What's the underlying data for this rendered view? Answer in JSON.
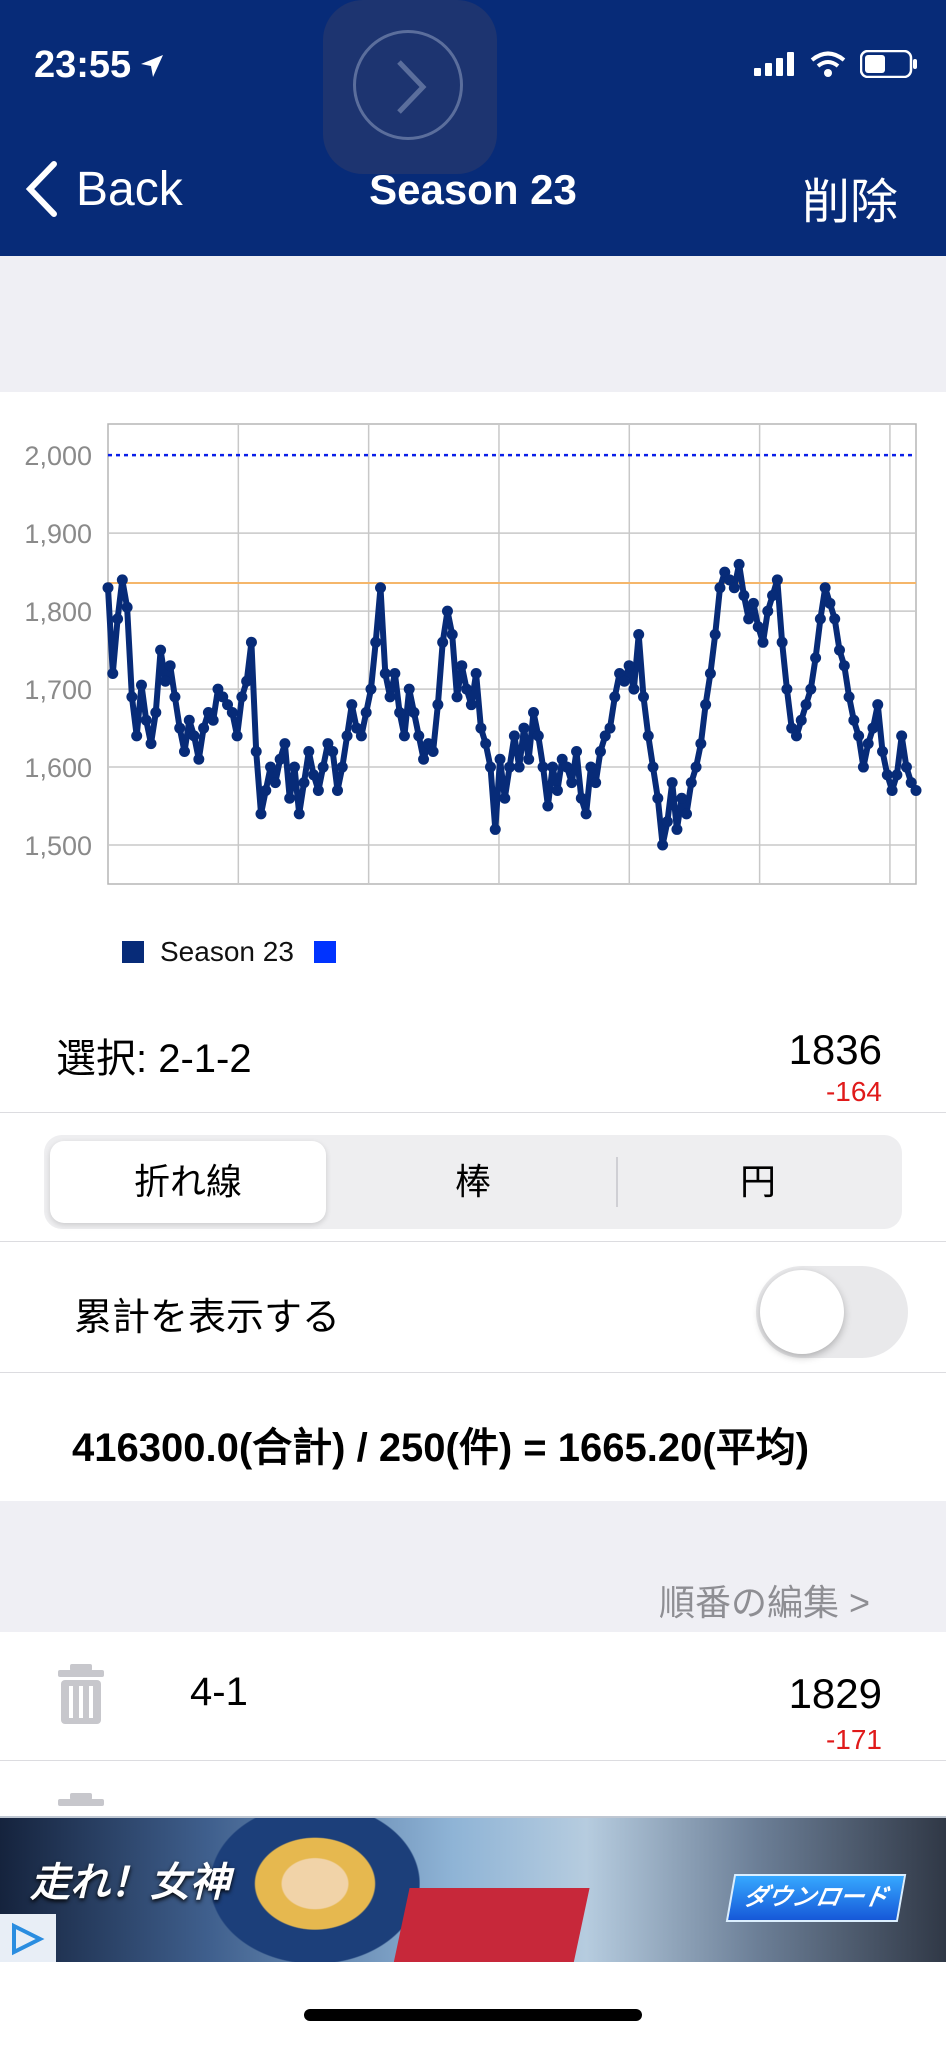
{
  "status_bar": {
    "time": "23:55"
  },
  "nav": {
    "back_label": "Back",
    "title": "Season 23",
    "delete_label": "削除"
  },
  "chart_data": {
    "type": "line",
    "ylim": [
      1450,
      2040
    ],
    "y_ticks": [
      "1,500",
      "1,600",
      "1,700",
      "1,800",
      "1,900",
      "2,000"
    ],
    "reference_line": 2000,
    "highlight": {
      "index": 198,
      "value": 1836
    },
    "series": [
      {
        "name": "Season 23",
        "color": "#072b78",
        "values": [
          1830,
          1720,
          1790,
          1840,
          1805,
          1690,
          1640,
          1705,
          1660,
          1630,
          1670,
          1750,
          1710,
          1730,
          1690,
          1650,
          1620,
          1660,
          1640,
          1610,
          1650,
          1670,
          1660,
          1700,
          1690,
          1680,
          1670,
          1640,
          1690,
          1710,
          1760,
          1620,
          1540,
          1570,
          1600,
          1580,
          1610,
          1630,
          1560,
          1600,
          1540,
          1580,
          1620,
          1590,
          1570,
          1600,
          1630,
          1620,
          1570,
          1600,
          1640,
          1680,
          1650,
          1640,
          1670,
          1700,
          1760,
          1830,
          1720,
          1690,
          1720,
          1670,
          1640,
          1700,
          1670,
          1640,
          1610,
          1630,
          1620,
          1680,
          1760,
          1800,
          1770,
          1690,
          1730,
          1700,
          1680,
          1720,
          1650,
          1630,
          1600,
          1520,
          1610,
          1560,
          1600,
          1640,
          1600,
          1650,
          1610,
          1670,
          1640,
          1600,
          1550,
          1600,
          1570,
          1610,
          1600,
          1580,
          1620,
          1560,
          1540,
          1600,
          1580,
          1620,
          1640,
          1650,
          1690,
          1720,
          1710,
          1730,
          1700,
          1770,
          1690,
          1640,
          1600,
          1560,
          1500,
          1530,
          1580,
          1520,
          1560,
          1540,
          1580,
          1600,
          1630,
          1680,
          1720,
          1770,
          1830,
          1850,
          1840,
          1830,
          1860,
          1820,
          1790,
          1810,
          1780,
          1760,
          1800,
          1820,
          1840,
          1760,
          1700,
          1650,
          1640,
          1660,
          1680,
          1700,
          1740,
          1790,
          1830,
          1810,
          1790,
          1750,
          1730,
          1690,
          1660,
          1640,
          1600,
          1630,
          1650,
          1680,
          1620,
          1590,
          1570,
          1590,
          1640,
          1600,
          1580,
          1570
        ],
        "values_note": ""
      }
    ]
  },
  "legend": {
    "series_label": "Season 23"
  },
  "selection": {
    "label": "選択: 2-1-2",
    "value": "1836",
    "diff": "-164"
  },
  "segments": {
    "items": [
      "折れ線",
      "棒",
      "円"
    ],
    "selected": 0
  },
  "cumulative": {
    "label": "累計を表示する",
    "on": false
  },
  "summary": {
    "text": "416300.0(合計) / 250(件) = 1665.20(平均)"
  },
  "edit_order": {
    "label": "順番の編集 >"
  },
  "list": [
    {
      "label": "4-1",
      "value": "1829",
      "diff": "-171"
    }
  ],
  "ad": {
    "title": "走れ！女神",
    "cta": "ダウンロード"
  }
}
